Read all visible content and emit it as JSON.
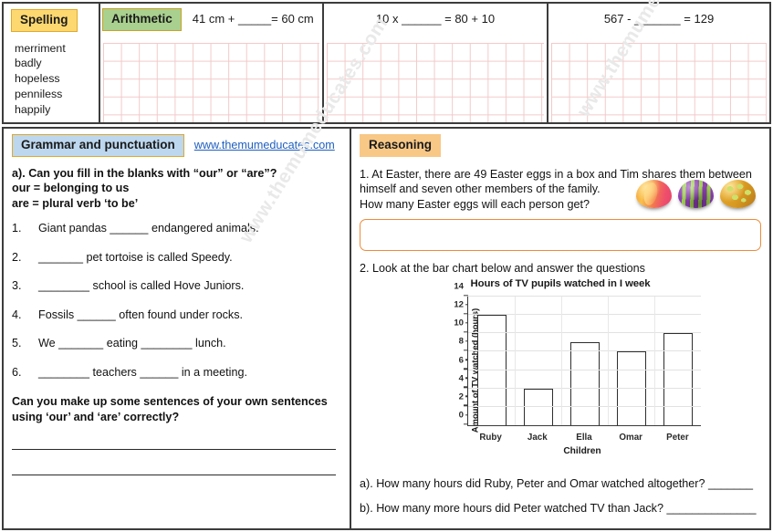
{
  "spelling": {
    "tag": "Spelling",
    "words": [
      "merriment",
      "badly",
      "hopeless",
      "penniless",
      "happily"
    ]
  },
  "arithmetic": {
    "tag": "Arithmetic",
    "questions": [
      "41 cm + _____=  60 cm",
      "10 x ______  =  80 + 10",
      "567 - _______ = 129"
    ]
  },
  "grammar": {
    "tag": "Grammar and punctuation",
    "link": "www.themumeducates.com",
    "intro_lines": [
      "a). Can you fill in the blanks with “our” or “are”?",
      "our = belonging to us",
      "are = plural verb ‘to be’"
    ],
    "questions": [
      {
        "num": "1.",
        "text": "Giant pandas ______ endangered animals."
      },
      {
        "num": "2.",
        "text": "_______ pet tortoise is called Speedy."
      },
      {
        "num": "3.",
        "text": "________ school is called Hove Juniors."
      },
      {
        "num": "4.",
        "text": "Fossils ______ often found under rocks."
      },
      {
        "num": "5.",
        "text": "We _______ eating ________ lunch."
      },
      {
        "num": "6.",
        "text": "________ teachers ______ in a meeting."
      }
    ],
    "own_sentences_line1": "Can you make up some sentences of your own sentences",
    "own_sentences_line2": "using ‘our’ and ‘are’ correctly?"
  },
  "reasoning": {
    "tag": "Reasoning",
    "q1_line1": "1. At Easter, there are 49 Easter eggs in a  box and Tim shares them between",
    "q1_line2": "himself and seven other members of the family.",
    "q1_line3": "How many Easter eggs will each person get?",
    "q1_answer_value": "",
    "q2_prompt": "2. Look at the bar chart below and answer the questions",
    "sub_a": "a). How many hours did Ruby, Peter and Omar watched altogether?  _______",
    "sub_b": "b). How many more hours did Peter watched TV than Jack? ______________",
    "egg_colors": [
      "#f27a4e",
      "#8b3fb0",
      "#e8a82b"
    ]
  },
  "watermark": {
    "text": "www.themumeducates.com"
  },
  "chart_data": {
    "type": "bar",
    "title": "Hours of TV pupils watched in I week",
    "xlabel": "Children",
    "ylabel": "Amount of TV watched (hours)",
    "categories": [
      "Ruby",
      "Jack",
      "Ella",
      "Omar",
      "Peter"
    ],
    "values": [
      12,
      4,
      9,
      8,
      10
    ],
    "ylim": [
      0,
      14
    ],
    "ytick_labels": [
      "0",
      "2",
      "4",
      "6",
      "8",
      "10",
      "12",
      "14"
    ],
    "ytick_values": [
      0,
      2,
      4,
      6,
      8,
      10,
      12,
      14
    ],
    "minor_ticks": [
      1,
      3,
      5,
      7,
      9,
      11,
      13
    ],
    "grid": true,
    "legend": "none",
    "bar_fill": "#ffffff",
    "bar_stroke": "#2e2e2e"
  },
  "theme": {
    "spelling_tag_bg": "#fdd870",
    "arithmetic_tag_bg": "#a9d08e",
    "grammar_tag_bg": "#bdd7ee",
    "reasoning_tag_bg": "#f8c887",
    "grid_color": "#f3c9c9",
    "link_color": "#1f5fbf",
    "answer_box_border": "#ed8b3b"
  }
}
